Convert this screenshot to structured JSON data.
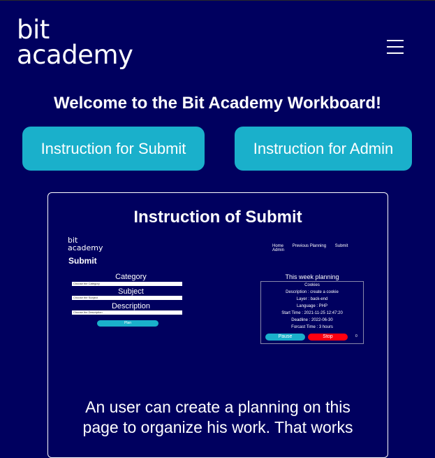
{
  "header": {
    "logo_line1": "bit",
    "logo_line2": "academy",
    "menu_icon": "hamburger-icon"
  },
  "welcome": "Welcome to the Bit Academy Workboard!",
  "buttons": {
    "submit": "Instruction for Submit",
    "admin": "Instruction for Admin"
  },
  "card": {
    "title": "Instruction of Submit",
    "description_line1": "An user can create a planning on this",
    "description_line2": "page to organize his work. That works",
    "screenshot": {
      "logo_line1": "bit",
      "logo_line2": "academy",
      "nav": [
        "Home",
        "Previous Planning",
        "Submit",
        "Admin"
      ],
      "title": "Submit",
      "category_label": "Category",
      "category_select": "Choose the Category",
      "subject_label": "Subject",
      "subject_select": "Choose the Subject",
      "description_label": "Description",
      "description_select": "Choose the Description",
      "plan_button": "Plan",
      "week_title": "This week planning",
      "planning": {
        "name": "Cookies",
        "description": "Description : create a cookie",
        "layer": "Layer : back-end",
        "language": "Language : PHP",
        "start_time": "Start Time : 2021-11-25 12:47:20",
        "deadline": "Deadline : 2022-06-30",
        "forecast": "Forcast Time : 3 hours"
      },
      "pause_button": "Pause",
      "stop_button": "Stop",
      "counter": "0"
    }
  }
}
